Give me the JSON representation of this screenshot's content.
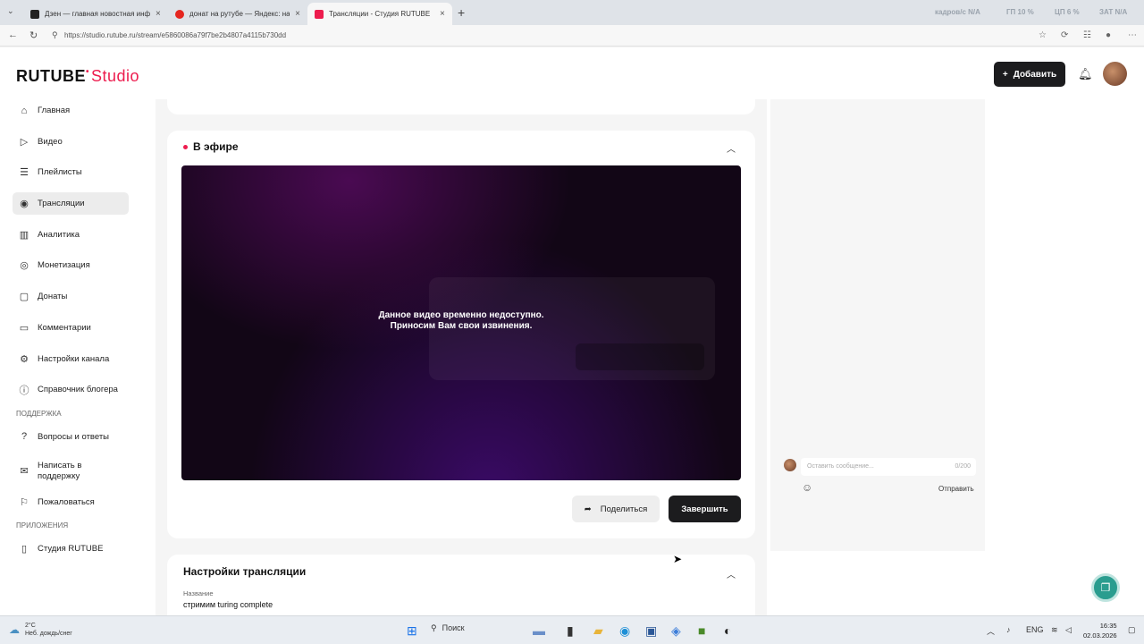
{
  "browser": {
    "tabs": [
      {
        "title": "Дзен — главная новостная инфо",
        "favicon_color": "#222222",
        "active": false
      },
      {
        "title": "донат на рутубе — Яндекс: нашл",
        "favicon_color": "#e52620",
        "active": false
      },
      {
        "title": "Трансляции - Студия RUTUBE",
        "favicon_color": "#ed1c4e",
        "active": true
      }
    ],
    "url": "https://studio.rutube.ru/stream/e5860086a79f7be2b4807a4115b730dd",
    "stats": [
      "кадров/с N/A",
      "ГП 10 %",
      "ЦП 6 %",
      "ЗАТ N/A"
    ]
  },
  "header": {
    "logo_main": "RUTUBE",
    "logo_sub": "Studio",
    "add_button": "Добавить"
  },
  "sidebar": {
    "items": [
      {
        "label": "Главная",
        "icon": "home-icon",
        "glyph": "⌂"
      },
      {
        "label": "Видео",
        "icon": "video-icon",
        "glyph": "▷"
      },
      {
        "label": "Плейлисты",
        "icon": "playlist-icon",
        "glyph": "☰"
      },
      {
        "label": "Трансляции",
        "icon": "broadcast-icon",
        "glyph": "◉",
        "active": true
      },
      {
        "label": "Аналитика",
        "icon": "analytics-icon",
        "glyph": "▥"
      },
      {
        "label": "Монетизация",
        "icon": "money-icon",
        "glyph": "◎"
      },
      {
        "label": "Донаты",
        "icon": "donate-icon",
        "glyph": "▢"
      },
      {
        "label": "Комментарии",
        "icon": "comments-icon",
        "glyph": "▭"
      },
      {
        "label": "Настройки канала",
        "icon": "settings-icon",
        "glyph": "⚙"
      },
      {
        "label": "Справочник блогера",
        "icon": "info-icon",
        "glyph": "ⓘ"
      }
    ],
    "support_title": "ПОДДЕРЖКА",
    "support_items": [
      {
        "label": "Вопросы и ответы",
        "icon": "faq-icon",
        "glyph": "?"
      },
      {
        "label": "Написать в поддержку",
        "icon": "mail-icon",
        "glyph": "✉"
      },
      {
        "label": "Пожаловаться",
        "icon": "flag-icon",
        "glyph": "⚐"
      }
    ],
    "apps_title": "ПРИЛОЖЕНИЯ",
    "apps_items": [
      {
        "label": "Студия RUTUBE",
        "icon": "phone-icon",
        "glyph": "▯"
      }
    ]
  },
  "live": {
    "title": "В эфире",
    "message_line1": "Данное видео временно недоступно.",
    "message_line2": "Приносим Вам свои извинения.",
    "share_button": "Поделиться",
    "end_button": "Завершить"
  },
  "settings": {
    "title": "Настройки трансляции",
    "name_label": "Название",
    "name_value": "стримим turing complete"
  },
  "chat": {
    "placeholder": "Оставить сообщение...",
    "counter": "0/200",
    "send_label": "Отправить"
  },
  "taskbar": {
    "temp": "2°C",
    "weather": "Неб. дождь/снег",
    "search": "Поиск",
    "lang": "ENG",
    "time": "16:35",
    "date": "02.03.2026"
  }
}
